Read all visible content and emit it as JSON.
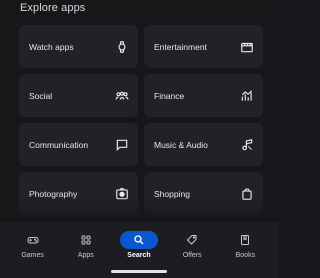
{
  "header": {
    "title": "Explore apps"
  },
  "tiles": [
    {
      "label": "Watch apps",
      "icon": "watch-icon"
    },
    {
      "label": "Entertainment",
      "icon": "clapperboard-icon"
    },
    {
      "label": "Social",
      "icon": "people-icon"
    },
    {
      "label": "Finance",
      "icon": "finance-icon"
    },
    {
      "label": "Communication",
      "icon": "chat-bubble-icon"
    },
    {
      "label": "Music & Audio",
      "icon": "music-note-icon"
    },
    {
      "label": "Photography",
      "icon": "camera-icon"
    },
    {
      "label": "Shopping",
      "icon": "shopping-bag-icon"
    }
  ],
  "nav": [
    {
      "label": "Games",
      "icon": "gamepad-icon",
      "active": false
    },
    {
      "label": "Apps",
      "icon": "apps-grid-icon",
      "active": false
    },
    {
      "label": "Search",
      "icon": "search-icon",
      "active": true
    },
    {
      "label": "Offers",
      "icon": "tag-icon",
      "active": false
    },
    {
      "label": "Books",
      "icon": "book-icon",
      "active": false
    }
  ],
  "colors": {
    "background": "#161719",
    "tile": "#202227",
    "accent": "#0b57d0",
    "navbar": "#1b1d21"
  }
}
